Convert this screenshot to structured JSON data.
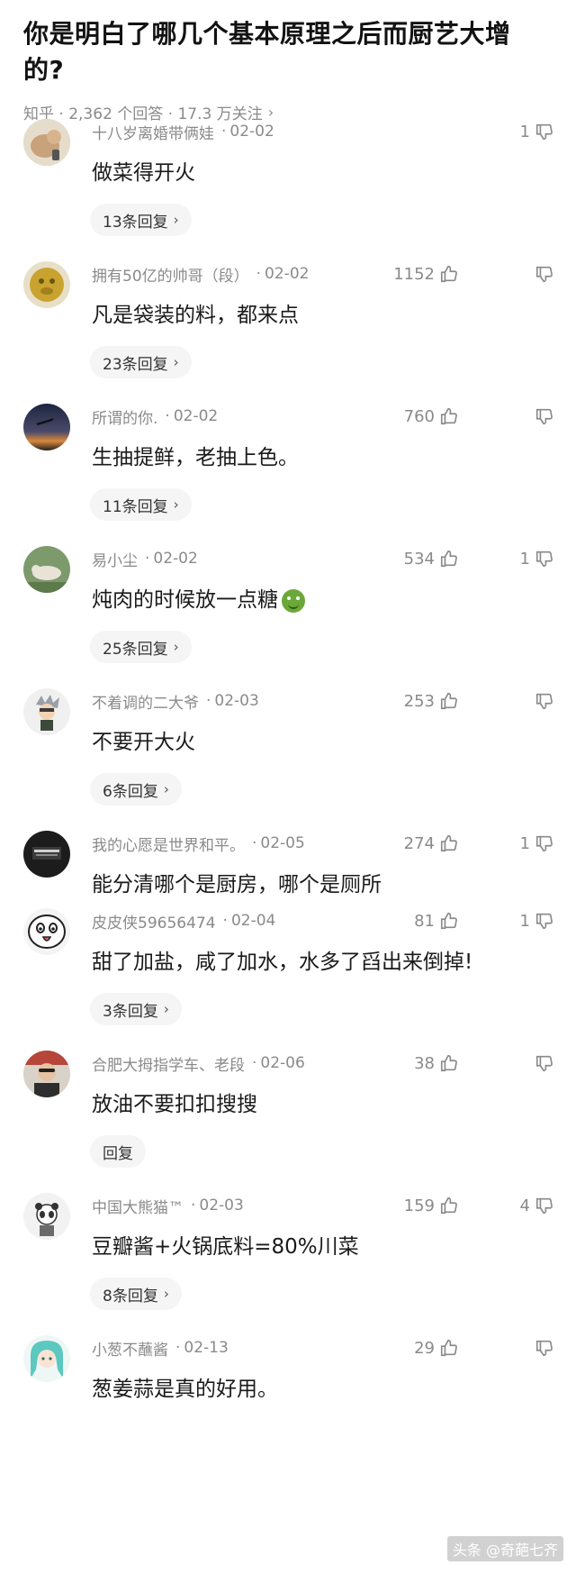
{
  "question": {
    "title_line1": "你是明白了哪几个基本原理之后而厨艺大增",
    "title_line2": "的?",
    "meta": "知乎 · 2,362 个回答 · 17.3 万关注"
  },
  "comments": [
    {
      "user": "十八岁离婚带俩娃",
      "date": "02-02",
      "text": "做菜得开火",
      "replies": "13条回复",
      "likes": "",
      "dislikes": "1",
      "avatar_color": "#d9c7a8"
    },
    {
      "user": "拥有50亿的帅哥（段）",
      "date": "02-02",
      "text": "凡是袋装的料，都来点",
      "replies": "23条回复",
      "likes": "1152",
      "dislikes": "",
      "avatar_color": "#b89a2e"
    },
    {
      "user": "所谓的你.",
      "date": "02-02",
      "text": "生抽提鲜，老抽上色。",
      "replies": "11条回复",
      "likes": "760",
      "dislikes": "",
      "avatar_color": "#3a3f55"
    },
    {
      "user": "易小尘",
      "date": "02-02",
      "text": "炖肉的时候放一点糖",
      "replies": "25条回复",
      "likes": "534",
      "dislikes": "1",
      "avatar_color": "#8a9a7a"
    },
    {
      "user": "不着调的二大爷",
      "date": "02-03",
      "text": "不要开大火",
      "replies": "6条回复",
      "likes": "253",
      "dislikes": "",
      "avatar_color": "#e8e8e8"
    },
    {
      "user": "我的心愿是世界和平。",
      "date": "02-05",
      "text": "能分清哪个是厨房，哪个是厕所",
      "replies": "",
      "likes": "274",
      "dislikes": "1",
      "avatar_color": "#222222"
    },
    {
      "user": "皮皮侠59656474",
      "date": "02-04",
      "text": "甜了加盐，咸了加水，水多了舀出来倒掉!",
      "replies": "3条回复",
      "likes": "81",
      "dislikes": "1",
      "avatar_color": "#f2f2f2"
    },
    {
      "user": "合肥大拇指学车、老段",
      "date": "02-06",
      "text": "放油不要扣扣搜搜",
      "replies": "回复",
      "likes": "38",
      "dislikes": "",
      "avatar_color": "#c9b8a8"
    },
    {
      "user": "中国大熊猫™",
      "date": "02-03",
      "text": "豆瓣酱+火锅底料=80%川菜",
      "replies": "8条回复",
      "likes": "159",
      "dislikes": "4",
      "avatar_color": "#eeeeee"
    },
    {
      "user": "小葱不蘸酱",
      "date": "02-13",
      "text": "葱姜蒜是真的好用。",
      "replies": "",
      "likes": "29",
      "dislikes": "",
      "avatar_color": "#bfe3e0"
    }
  ],
  "watermark": "头条 @奇葩七齐",
  "colors": {
    "muted": "#8a8a8a",
    "text": "#1a1a1a",
    "reply_bg": "#f5f5f5"
  }
}
